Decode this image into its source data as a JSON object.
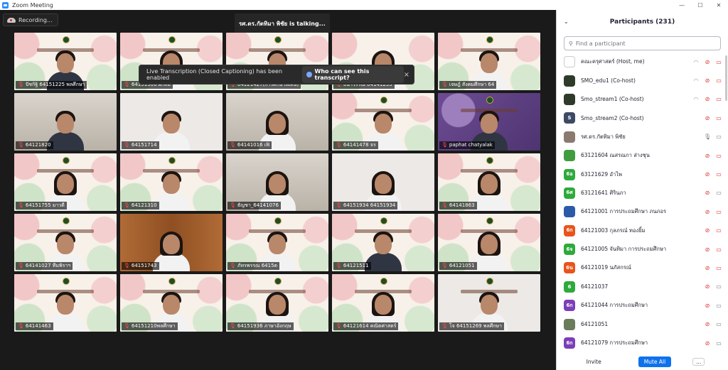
{
  "window": {
    "title": "Zoom Meeting"
  },
  "recording": {
    "label": "Recording..."
  },
  "talking": {
    "text": "รศ.ดร.กัตทิมา พิชัย is talking..."
  },
  "caption_popup": {
    "text": "Live Transcription (Closed Captioning) has been enabled",
    "who_label": "Who can see this transcript?",
    "close": "×"
  },
  "tiles": [
    {
      "label": "ปัชกิฐิ 64151225 พลศึกษา",
      "muted": true
    },
    {
      "label": "64151906 ผกัสม",
      "muted": true
    },
    {
      "label": "64121427(การศึกษาพิเศษ)",
      "muted": true
    },
    {
      "label": "ธนาวรรณ 64141255",
      "muted": true
    },
    {
      "label": "เจษฎ์ สังคมศึกษา 64",
      "muted": true
    },
    {
      "label": "64121820",
      "muted": true
    },
    {
      "label": "64151714",
      "muted": true
    },
    {
      "label": "64141016 เฟิ",
      "muted": true
    },
    {
      "label": "64141478 จร",
      "muted": true
    },
    {
      "label": "paphat chatyalak",
      "muted": true
    },
    {
      "label": "64151755 มาวดี",
      "muted": true
    },
    {
      "label": "64121310",
      "muted": true
    },
    {
      "label": "ธัญชา_64141076",
      "muted": true
    },
    {
      "label": "64151934 64151934",
      "muted": true
    },
    {
      "label": "64141863",
      "muted": true
    },
    {
      "label": "64141027 ทีมพิราฯ",
      "muted": true
    },
    {
      "label": "64151743",
      "muted": true
    },
    {
      "label": "ภัทรพรรณ 6415ต",
      "muted": true
    },
    {
      "label": "64121511",
      "muted": true
    },
    {
      "label": "64121051",
      "muted": true
    },
    {
      "label": "64141463",
      "muted": true
    },
    {
      "label": "64151210พลศึกษา",
      "muted": true
    },
    {
      "label": "64151936 ภาษาอังกฤษ",
      "muted": true
    },
    {
      "label": "64121614 คณิตศาสตร์",
      "muted": true
    },
    {
      "label": "โจ 64151269 พลศึกษา",
      "muted": true
    }
  ],
  "participants": {
    "title": "Participants (231)",
    "search_placeholder": "Find a participant",
    "list": [
      {
        "name": "คณะครุศาสตร์ (Host, me)",
        "avatar_text": "",
        "color": "#ffffff"
      },
      {
        "name": "SMO_edu1 (Co-host)",
        "avatar_text": "",
        "color": "#2f3b2a"
      },
      {
        "name": "Smo_stream1 (Co-host)",
        "avatar_text": "",
        "color": "#2f3b2a"
      },
      {
        "name": "Smo_stream2 (Co-host)",
        "avatar_text": "S",
        "color": "#3c4a64"
      },
      {
        "name": "รศ.ดร.กัตทิมา พิชัย",
        "avatar_text": "",
        "color": "#8a7a70"
      },
      {
        "name": "63121604 ณสรณกา ส่างชุน",
        "avatar_text": "",
        "color": "#3f9d3f"
      },
      {
        "name": "63121629 อำไพ",
        "avatar_text": "6อ",
        "color": "#2eaa3c"
      },
      {
        "name": "63121641 ศิรินภา",
        "avatar_text": "6ศ",
        "color": "#2eaa3c"
      },
      {
        "name": "64121001 การประถมศึกษา ภนภอร",
        "avatar_text": "",
        "color": "#2a5aa8"
      },
      {
        "name": "64121003 กุลภรณ์ ทองยิ้ม",
        "avatar_text": "6ก",
        "color": "#e8541c"
      },
      {
        "name": "64121005 จันทิมา การประถมศึกษา",
        "avatar_text": "6จ",
        "color": "#2eaa3c"
      },
      {
        "name": "64121019 นภัสกรณ์",
        "avatar_text": "6น",
        "color": "#e8541c"
      },
      {
        "name": "64121037",
        "avatar_text": "6",
        "color": "#2eaa3c"
      },
      {
        "name": "64121044 การประถมศึกษา",
        "avatar_text": "6ก",
        "color": "#7b3fb8"
      },
      {
        "name": "64121051",
        "avatar_text": "",
        "color": "#6a7c5a"
      },
      {
        "name": "64121079 การประถมศึกษา",
        "avatar_text": "6ก",
        "color": "#7b3fb8"
      }
    ],
    "invite_label": "Invite",
    "mute_all_label": "Mute All",
    "more_label": "..."
  }
}
